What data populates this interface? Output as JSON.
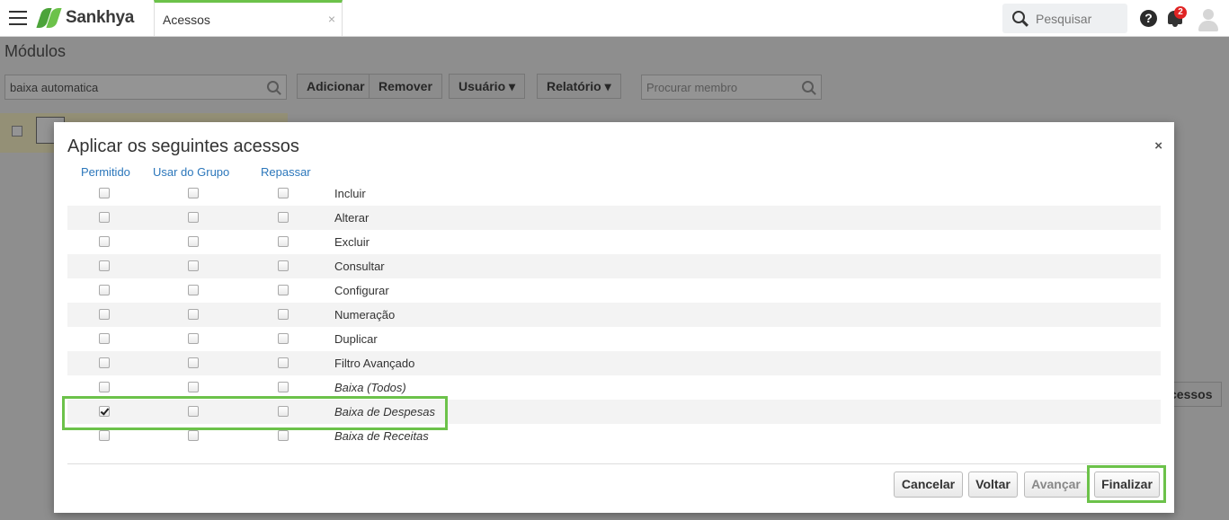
{
  "topbar": {
    "logo_text": "Sankhya",
    "tab_label": "Acessos",
    "tab_close": "×",
    "search_placeholder": "Pesquisar",
    "help_glyph": "?",
    "notification_count": "2"
  },
  "background": {
    "page_title": "Módulos",
    "search_value": "baixa automatica",
    "buttons": [
      "Adicionar",
      "Remover",
      "Usuário ▾",
      "Relatório ▾"
    ],
    "member_search_placeholder": "Procurar membro",
    "partial_button": "cessos"
  },
  "modal": {
    "title": "Aplicar os seguintes acessos",
    "close": "×",
    "columns": [
      "Permitido",
      "Usar do Grupo",
      "Repassar"
    ],
    "rows": [
      {
        "label": "Incluir",
        "italic": false,
        "permitido": false,
        "grupo": false,
        "repassar": false
      },
      {
        "label": "Alterar",
        "italic": false,
        "permitido": false,
        "grupo": false,
        "repassar": false
      },
      {
        "label": "Excluir",
        "italic": false,
        "permitido": false,
        "grupo": false,
        "repassar": false
      },
      {
        "label": "Consultar",
        "italic": false,
        "permitido": false,
        "grupo": false,
        "repassar": false
      },
      {
        "label": "Configurar",
        "italic": false,
        "permitido": false,
        "grupo": false,
        "repassar": false
      },
      {
        "label": "Numeração",
        "italic": false,
        "permitido": false,
        "grupo": false,
        "repassar": false
      },
      {
        "label": "Duplicar",
        "italic": false,
        "permitido": false,
        "grupo": false,
        "repassar": false
      },
      {
        "label": "Filtro Avançado",
        "italic": false,
        "permitido": false,
        "grupo": false,
        "repassar": false
      },
      {
        "label": "Baixa (Todos)",
        "italic": true,
        "permitido": false,
        "grupo": false,
        "repassar": false
      },
      {
        "label": "Baixa de Despesas",
        "italic": true,
        "permitido": true,
        "grupo": false,
        "repassar": false
      },
      {
        "label": "Baixa de Receitas",
        "italic": true,
        "permitido": false,
        "grupo": false,
        "repassar": false
      }
    ],
    "footer": {
      "cancel": "Cancelar",
      "back": "Voltar",
      "next": "Avançar",
      "finish": "Finalizar"
    }
  },
  "colors": {
    "accent_green": "#6cc24a",
    "link_blue": "#2c77bb",
    "badge_red": "#e02424"
  }
}
